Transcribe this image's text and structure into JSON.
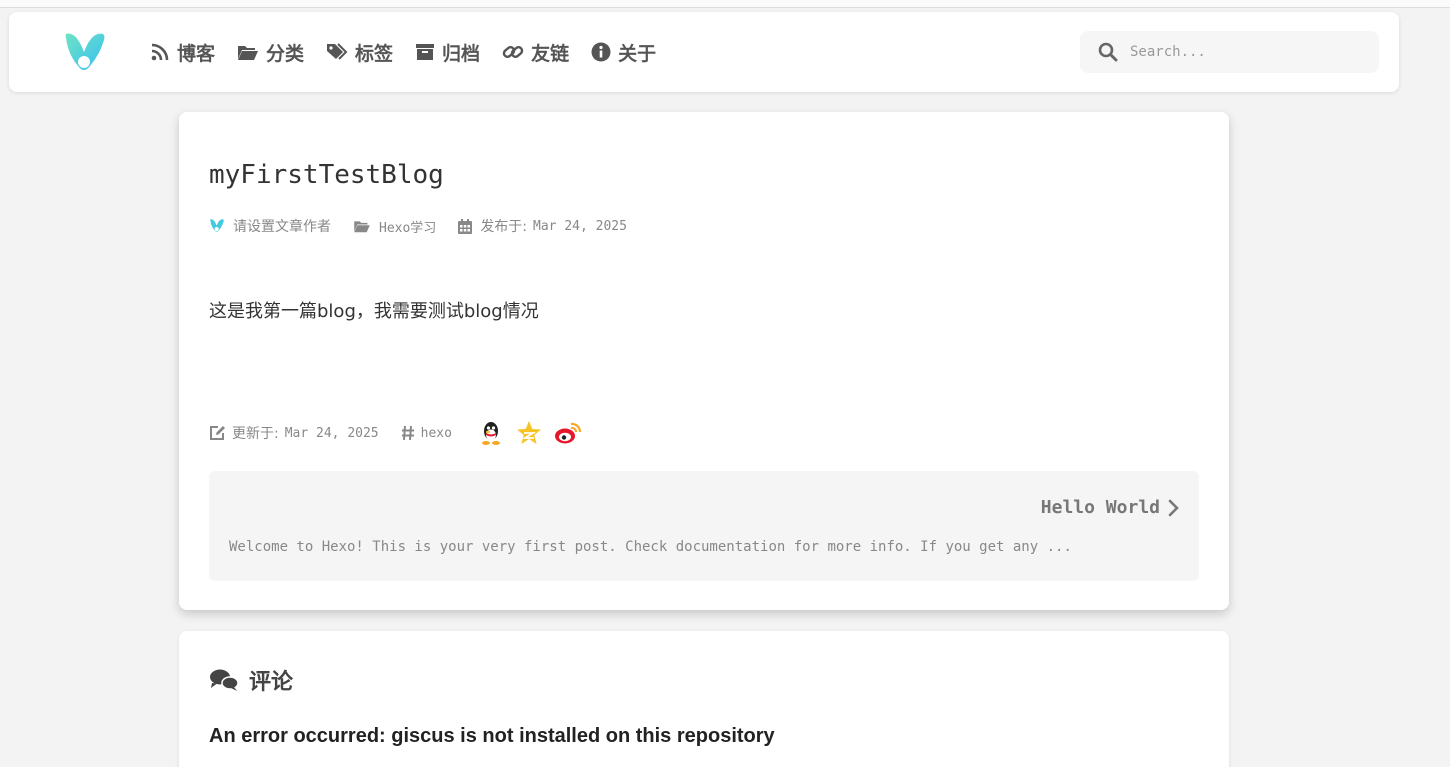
{
  "header": {
    "nav": [
      {
        "label": "博客",
        "icon": "rss-icon"
      },
      {
        "label": "分类",
        "icon": "folder-open-icon"
      },
      {
        "label": "标签",
        "icon": "tags-icon"
      },
      {
        "label": "归档",
        "icon": "archive-icon"
      },
      {
        "label": "友链",
        "icon": "link-icon"
      },
      {
        "label": "关于",
        "icon": "info-circle-icon"
      }
    ],
    "search": {
      "placeholder": "Search..."
    }
  },
  "post": {
    "title": "myFirstTestBlog",
    "author": "请设置文章作者",
    "category": "Hexo学习",
    "published_label": "发布于:",
    "published_date": "Mar 24, 2025",
    "content": "这是我第一篇blog，我需要测试blog情况",
    "updated_label": "更新于:",
    "updated_date": "Mar 24, 2025",
    "tag": "hexo",
    "share_icons": [
      "qq-icon",
      "qzone-icon",
      "weibo-icon"
    ]
  },
  "next_post": {
    "title": "Hello World",
    "excerpt": "Welcome to Hexo! This is your very first post. Check documentation for more info. If you get any ..."
  },
  "comments": {
    "title": "评论",
    "error": "An error occurred: giscus is not installed on this repository"
  },
  "colors": {
    "logo_teal": "#5ad7c8",
    "logo_blue": "#3ec3f0",
    "page_bg": "#f3f3f3",
    "weibo_red": "#e6162d",
    "qzone_yellow": "#f7c324"
  }
}
